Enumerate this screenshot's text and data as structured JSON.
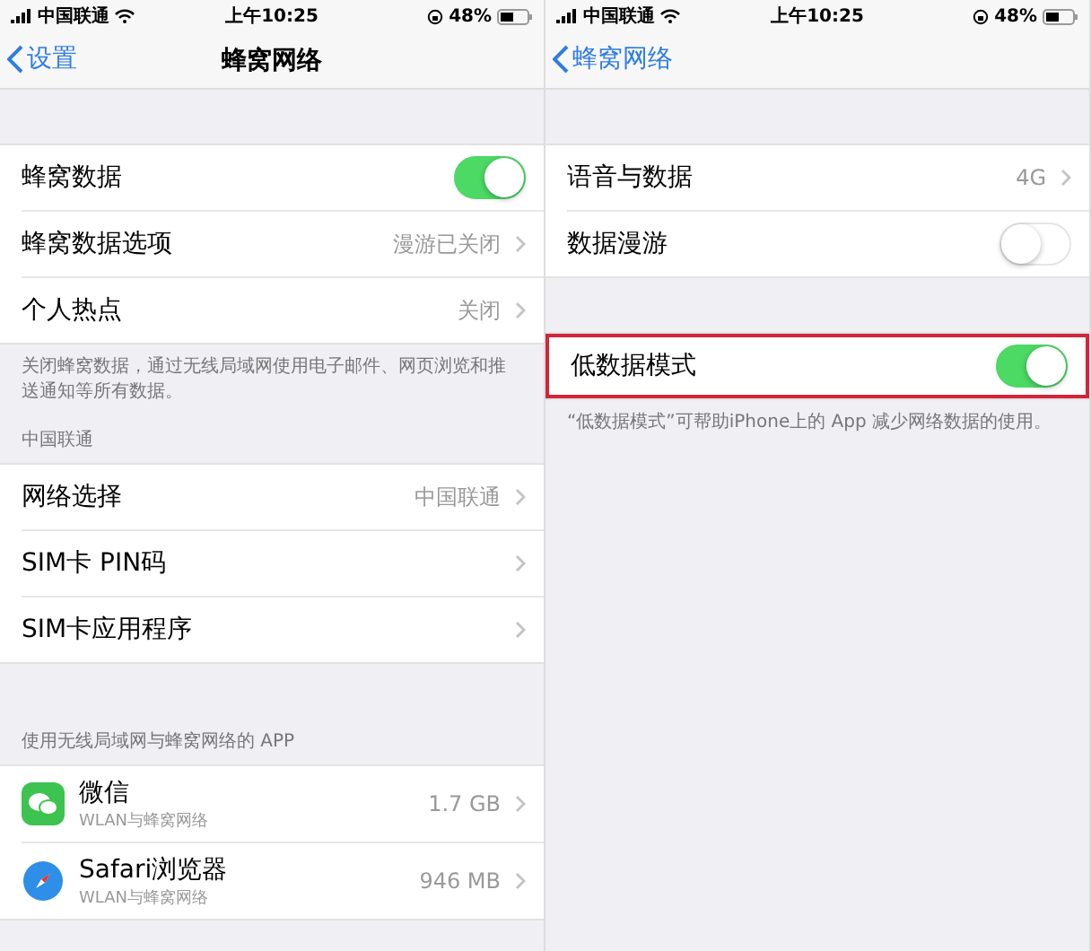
{
  "panels": [
    {
      "status_bar": {
        "carrier": "中国联通",
        "time": "上午10:25",
        "battery": "48%"
      },
      "nav": {
        "back": "设置",
        "title": "蜂窝网络"
      },
      "sections": [
        {
          "rows": [
            {
              "kind": "toggle",
              "label": "蜂窝数据",
              "on": true,
              "highlighted": false
            },
            {
              "kind": "detail",
              "label": "蜂窝数据选项",
              "value": "漫游已关闭",
              "highlighted": false
            },
            {
              "kind": "detail",
              "label": "个人热点",
              "value": "关闭",
              "highlighted": false
            }
          ],
          "footer": "关闭蜂窝数据，通过无线局域网使用电子邮件、网页浏览和推送通知等所有数据。"
        },
        {
          "header": "中国联通",
          "rows": [
            {
              "kind": "detail",
              "label": "网络选择",
              "value": "中国联通",
              "highlighted": false
            },
            {
              "kind": "detail",
              "label": "SIM卡 PIN码",
              "highlighted": false
            },
            {
              "kind": "detail",
              "label": "SIM卡应用程序",
              "highlighted": false
            }
          ]
        },
        {
          "header": "使用无线局域网与蜂窝网络的 APP",
          "rows": [
            {
              "kind": "app",
              "label": "微信",
              "subtitle": "WLAN与蜂窝网络",
              "value": "1.7 GB",
              "highlighted": false
            },
            {
              "kind": "app",
              "label": "Safari浏览器",
              "subtitle": "WLAN与蜂窝网络",
              "value": "946 MB",
              "highlighted": false
            }
          ]
        }
      ]
    },
    {
      "status_bar": {
        "carrier": "中国联通",
        "time": "上午10:25",
        "battery": "48%"
      },
      "nav": {
        "back": "蜂窝网络"
      },
      "sections": [
        {
          "rows": [
            {
              "kind": "detail",
              "label": "语音与数据",
              "value": "4G",
              "highlighted": false
            },
            {
              "kind": "toggle",
              "label": "数据漫游",
              "on": false,
              "highlighted": false
            }
          ]
        },
        {
          "rows": [
            {
              "kind": "toggle",
              "label": "低数据模式",
              "on": true,
              "highlighted": true
            }
          ],
          "footer": "“低数据模式”可帮助iPhone上的 App 减少网络数据的使用。"
        }
      ]
    }
  ]
}
